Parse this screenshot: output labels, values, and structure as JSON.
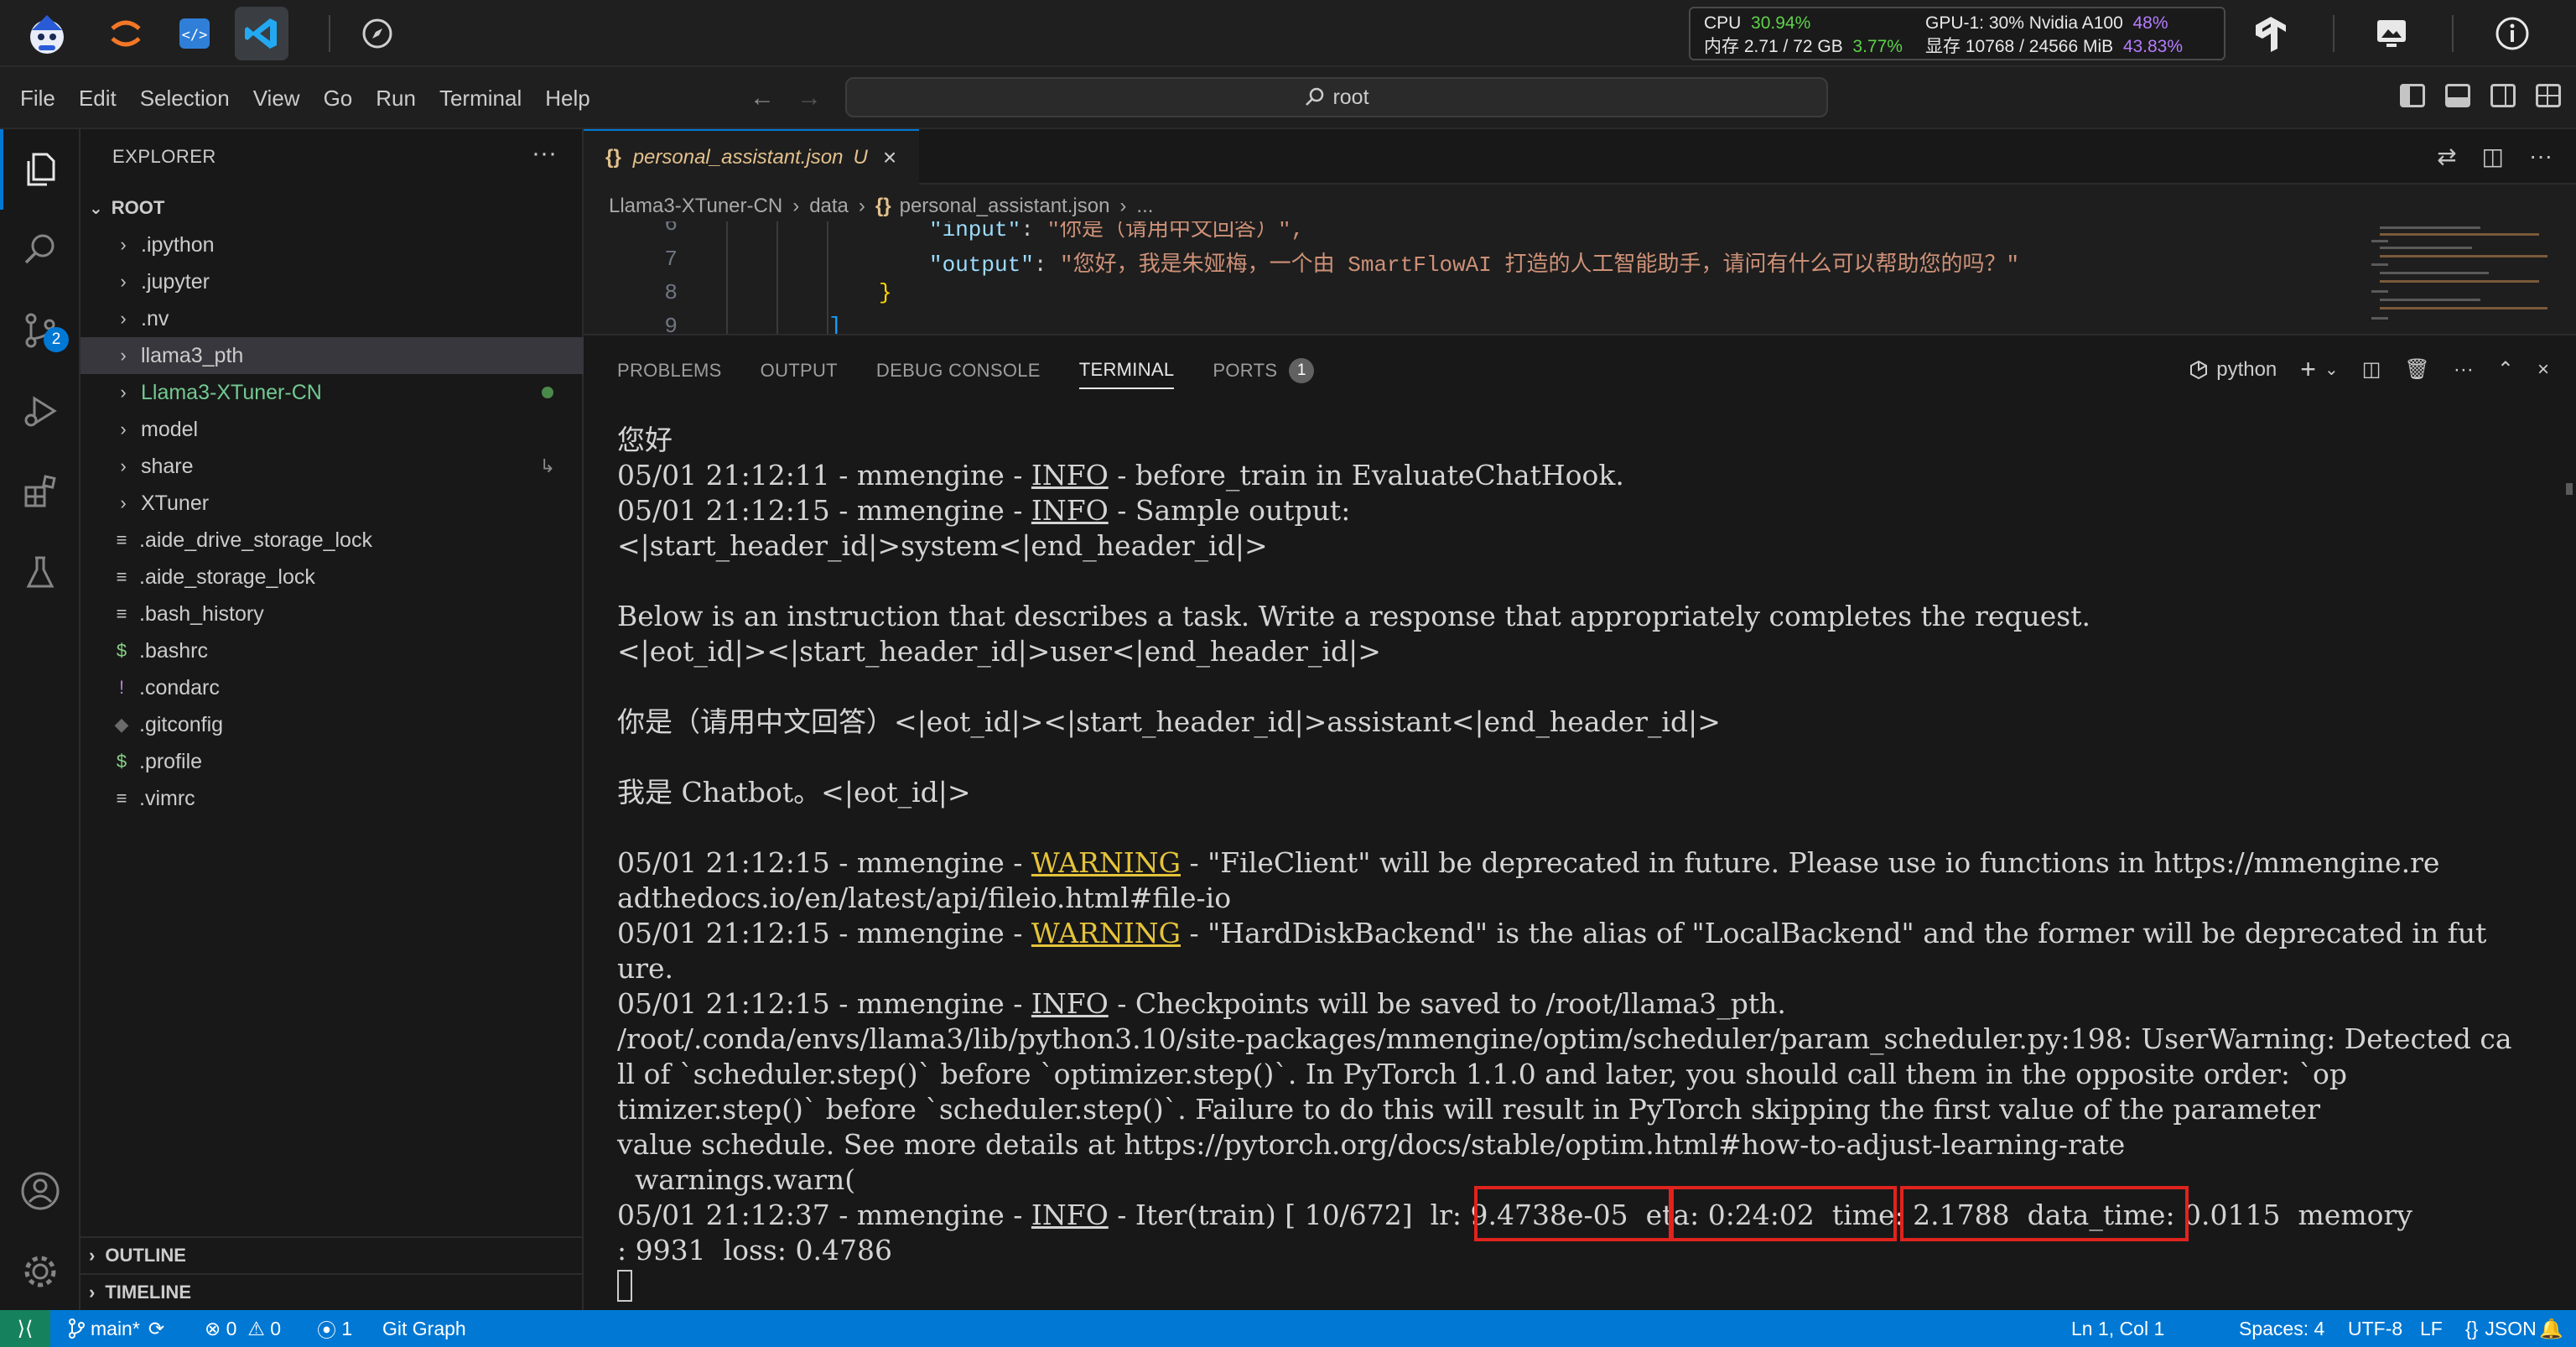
{
  "topbar": {
    "cpu_label": "CPU",
    "cpu_value": "30.94%",
    "mem_label": "内存 2.71 / 72 GB",
    "mem_pct": "3.77%",
    "gpu_label": "GPU-1: 30% Nvidia A100",
    "gpu_pct": "48%",
    "vram_label": "显存 10768 / 24566 MiB",
    "vram_pct": "43.83%"
  },
  "menu": [
    "File",
    "Edit",
    "Selection",
    "View",
    "Go",
    "Run",
    "Terminal",
    "Help"
  ],
  "command_center": "root",
  "activity": {
    "scm_badge": "2"
  },
  "explorer": {
    "header": "EXPLORER",
    "more": "···",
    "root": "ROOT",
    "items": [
      {
        "label": ".ipython",
        "type": "folder"
      },
      {
        "label": ".jupyter",
        "type": "folder"
      },
      {
        "label": ".nv",
        "type": "folder"
      },
      {
        "label": "llama3_pth",
        "type": "folder",
        "selected": true
      },
      {
        "label": "Llama3-XTuner-CN",
        "type": "folder",
        "modified": true
      },
      {
        "label": "model",
        "type": "folder"
      },
      {
        "label": "share",
        "type": "folder",
        "linked": true
      },
      {
        "label": "XTuner",
        "type": "folder"
      },
      {
        "label": ".aide_drive_storage_lock",
        "type": "file"
      },
      {
        "label": ".aide_storage_lock",
        "type": "file"
      },
      {
        "label": ".bash_history",
        "type": "file"
      },
      {
        "label": ".bashrc",
        "type": "shell"
      },
      {
        "label": ".condarc",
        "type": "warn"
      },
      {
        "label": ".gitconfig",
        "type": "git"
      },
      {
        "label": ".profile",
        "type": "shell"
      },
      {
        "label": ".vimrc",
        "type": "file"
      }
    ],
    "outline": "OUTLINE",
    "timeline": "TIMELINE"
  },
  "editor": {
    "tab_icon": "{}",
    "tab_name": "personal_assistant.json",
    "tab_state": "U",
    "breadcrumb": [
      "Llama3-XTuner-CN",
      "data",
      "personal_assistant.json",
      "..."
    ],
    "lines": [
      {
        "num": "6",
        "key": "\"input\"",
        "val": "\"你是（请用中文回答）\","
      },
      {
        "num": "6",
        "key": "\"output\"",
        "val": "\"您好，我是朱娅梅，一个由 SmartFlowAI 打造的人工智能助手，请问有什么可以帮助您的吗？\""
      },
      {
        "num": "7",
        "key": "",
        "val": ""
      },
      {
        "num": "8",
        "key": "",
        "val": ""
      },
      {
        "num": "9",
        "key": "",
        "val": ""
      }
    ]
  },
  "panel": {
    "tabs": [
      "PROBLEMS",
      "OUTPUT",
      "DEBUG CONSOLE",
      "TERMINAL",
      "PORTS"
    ],
    "ports_badge": "1",
    "shell": "python"
  },
  "terminal": {
    "l1": "您好",
    "l2a": "05/01 21:12:11 - mmengine - ",
    "l2b": "INFO",
    "l2c": " - before_train in EvaluateChatHook.",
    "l3a": "05/01 21:12:15 - mmengine - ",
    "l3b": "INFO",
    "l3c": " - Sample output:",
    "l4": "<|start_header_id|>system<|end_header_id|>",
    "l5": "Below is an instruction that describes a task. Write a response that appropriately completes the request.",
    "l6": "<|eot_id|><|start_header_id|>user<|end_header_id|>",
    "l7": "你是（请用中文回答）<|eot_id|><|start_header_id|>assistant<|end_header_id|>",
    "l8": "我是 Chatbot。<|eot_id|>",
    "l9a": "05/01 21:12:15 - mmengine - ",
    "l9b": "WARNING",
    "l9c": " - \"FileClient\" will be deprecated in future. Please use io functions in https://mmengine.re",
    "l10": "adthedocs.io/en/latest/api/fileio.html#file-io",
    "l11a": "05/01 21:12:15 - mmengine - ",
    "l11b": "WARNING",
    "l11c": " - \"HardDiskBackend\" is the alias of \"LocalBackend\" and the former will be deprecated in fut",
    "l12": "ure.",
    "l13a": "05/01 21:12:15 - mmengine - ",
    "l13b": "INFO",
    "l13c": " - Checkpoints will be saved to /root/llama3_pth.",
    "l14": "/root/.conda/envs/llama3/lib/python3.10/site-packages/mmengine/optim/scheduler/param_scheduler.py:198: UserWarning: Detected ca",
    "l15": "ll of `scheduler.step()` before `optimizer.step()`. In PyTorch 1.1.0 and later, you should call them in the opposite order: `op",
    "l16": "timizer.step()` before `scheduler.step()`. Failure to do this will result in PyTorch skipping the first value of the parameter",
    "l17": "value schedule. See more details at https://pytorch.org/docs/stable/optim.html#how-to-adjust-learning-rate",
    "l18": "  warnings.warn(",
    "l19a": "05/01 21:12:37 - mmengine - ",
    "l19b": "INFO",
    "l19c": " - Iter(train) [ 10/672]  lr: 9.4738e-05  eta: 0:24:02  time: 2.1788  data_time: 0.0115  memory",
    "l20": ": 9931  loss: 0.4786"
  },
  "statusbar": {
    "branch": "main*",
    "errors": "0",
    "warnings": "0",
    "ports": "1",
    "git_graph": "Git Graph",
    "position": "Ln 1, Col 1",
    "spaces": "Spaces: 4",
    "encoding": "UTF-8",
    "eol": "LF",
    "language": "JSON"
  }
}
